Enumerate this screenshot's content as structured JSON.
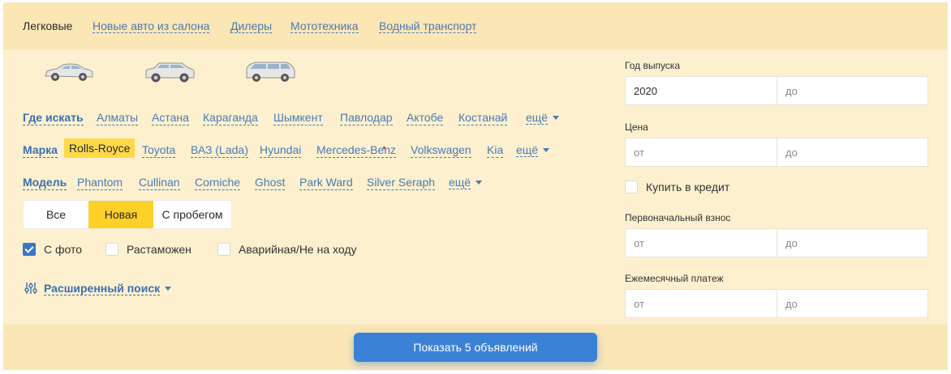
{
  "topnav": {
    "tabs": [
      {
        "label": "Легковые",
        "active": true
      },
      {
        "label": "Новые авто из салона"
      },
      {
        "label": "Дилеры"
      },
      {
        "label": "Мототехника"
      },
      {
        "label": "Водный транспорт"
      }
    ]
  },
  "body_types": [
    "sedan-icon",
    "suv-icon",
    "minivan-icon"
  ],
  "location": {
    "label": "Где искать",
    "cities": [
      "Алматы",
      "Астана",
      "Караганда",
      "Шымкент",
      "Павлодар",
      "Актобе",
      "Костанай"
    ],
    "more": "ещё"
  },
  "brand": {
    "label": "Марка",
    "selected": "Rolls-Royce",
    "items": [
      "Toyota",
      "ВАЗ (Lada)",
      "Hyundai",
      "Mercedes-Benz",
      "Volkswagen",
      "Kia"
    ],
    "more": "ещё"
  },
  "model": {
    "label": "Модель",
    "items": [
      "Phantom",
      "Cullinan",
      "Corniche",
      "Ghost",
      "Park Ward",
      "Silver Seraph"
    ],
    "more": "ещё"
  },
  "condition": {
    "options": [
      "Все",
      "Новая",
      "С пробегом"
    ],
    "selected": "Новая"
  },
  "checkboxes": [
    {
      "label": "С фото",
      "checked": true
    },
    {
      "label": "Растаможен",
      "checked": false
    },
    {
      "label": "Аварийная/Не на ходу",
      "checked": false
    }
  ],
  "advanced_search": "Расширенный поиск",
  "filters": {
    "year": {
      "label": "Год выпуска",
      "from_value": "2020",
      "to_placeholder": "до"
    },
    "price": {
      "label": "Цена",
      "from_placeholder": "от",
      "to_placeholder": "до"
    },
    "credit": {
      "label": "Купить в кредит",
      "checked": false
    },
    "down_payment": {
      "label": "Первоначальный взнос",
      "from_placeholder": "от",
      "to_placeholder": "до"
    },
    "monthly": {
      "label": "Ежемесячный платеж",
      "from_placeholder": "от",
      "to_placeholder": "до"
    }
  },
  "show_button": "Показать 5 объявлений",
  "colors": {
    "accent": "#3b82d6",
    "highlight": "#ffd028",
    "link": "#4a7ab3",
    "panel": "#fdf0cf",
    "bar": "#fbe6b6"
  }
}
